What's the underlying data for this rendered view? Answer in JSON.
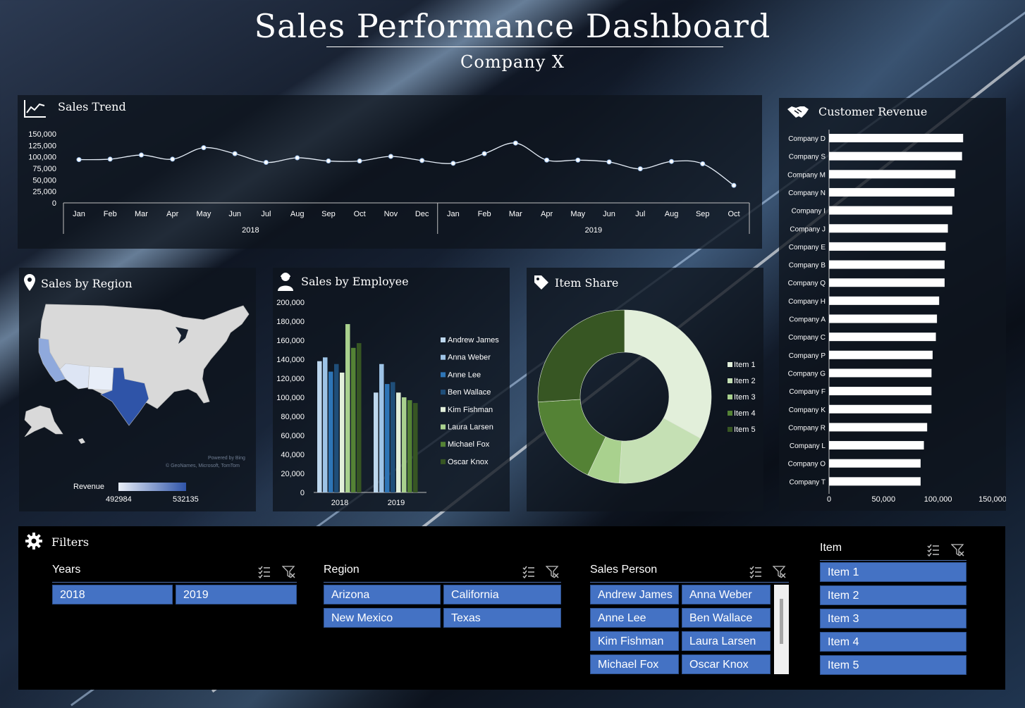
{
  "header": {
    "title": "Sales Performance Dashboard",
    "subtitle": "Company X"
  },
  "panels": {
    "trend": "Sales Trend",
    "region": "Sales by Region",
    "employee": "Sales by Employee",
    "item_share": "Item Share",
    "customer": "Customer Revenue",
    "filters": "Filters"
  },
  "region_map": {
    "legend_label": "Revenue",
    "legend_min": "492984",
    "legend_max": "532135",
    "credit1": "Powered by Bing",
    "credit2": "© GeoNames, Microsoft, TomTom",
    "colors": {
      "low": "#e8eef8",
      "high": "#2f54a8",
      "land": "#d9d9d9"
    }
  },
  "chart_data": [
    {
      "type": "line",
      "title": "Sales Trend",
      "x": [
        "Jan",
        "Feb",
        "Mar",
        "Apr",
        "May",
        "Jun",
        "Jul",
        "Aug",
        "Sep",
        "Oct",
        "Nov",
        "Dec",
        "Jan",
        "Feb",
        "Mar",
        "Apr",
        "May",
        "Jun",
        "Jul",
        "Aug",
        "Sep",
        "Oct"
      ],
      "groups": [
        {
          "label": "2018",
          "count": 12
        },
        {
          "label": "2019",
          "count": 10
        }
      ],
      "values": [
        94000,
        95000,
        104000,
        95000,
        120000,
        107000,
        88000,
        98000,
        91000,
        91000,
        101000,
        92000,
        86000,
        107000,
        130000,
        93000,
        93000,
        89000,
        74000,
        90000,
        85000,
        38000
      ],
      "yticks": [
        "150,000",
        "125,000",
        "100,000",
        "75,000",
        "50,000",
        "25,000",
        "0"
      ],
      "ylim": [
        0,
        150000
      ]
    },
    {
      "type": "bar",
      "title": "Sales by Employee",
      "categories": [
        "2018",
        "2019"
      ],
      "yticks": [
        "200,000",
        "180,000",
        "160,000",
        "140,000",
        "120,000",
        "100,000",
        "80,000",
        "60,000",
        "40,000",
        "20,000",
        "0"
      ],
      "ylim": [
        0,
        200000
      ],
      "series": [
        {
          "name": "Andrew James",
          "color": "#bdd7ee",
          "values": [
            138000,
            105000
          ]
        },
        {
          "name": "Anna Weber",
          "color": "#9dc3e6",
          "values": [
            142000,
            135000
          ]
        },
        {
          "name": "Anne Lee",
          "color": "#2e75b6",
          "values": [
            127000,
            114000
          ]
        },
        {
          "name": "Ben Wallace",
          "color": "#1f4e79",
          "values": [
            135000,
            116000
          ]
        },
        {
          "name": "Kim Fishman",
          "color": "#e2efda",
          "values": [
            126000,
            105000
          ]
        },
        {
          "name": "Laura Larsen",
          "color": "#a9d18e",
          "values": [
            177000,
            100000
          ]
        },
        {
          "name": "Michael Fox",
          "color": "#548235",
          "values": [
            152000,
            97000
          ]
        },
        {
          "name": "Oscar Knox",
          "color": "#375623",
          "values": [
            157000,
            94000
          ]
        }
      ]
    },
    {
      "type": "pie",
      "title": "Item Share",
      "labels": [
        "Item 1",
        "Item 2",
        "Item 3",
        "Item 4",
        "Item 5"
      ],
      "values": [
        33,
        18,
        6,
        17,
        26
      ],
      "colors": [
        "#e2efda",
        "#c5e0b4",
        "#a9d18e",
        "#548235",
        "#375623"
      ]
    },
    {
      "type": "bar",
      "orientation": "horizontal",
      "title": "Customer Revenue",
      "categories": [
        "Company D",
        "Company S",
        "Company M",
        "Company N",
        "Company I",
        "Company J",
        "Company E",
        "Company B",
        "Company Q",
        "Company H",
        "Company A",
        "Company C",
        "Company P",
        "Company G",
        "Company F",
        "Company K",
        "Company R",
        "Company L",
        "Company O",
        "Company T"
      ],
      "values": [
        123000,
        122000,
        116000,
        115000,
        113000,
        109000,
        107000,
        106000,
        106000,
        101000,
        99000,
        98000,
        95000,
        94000,
        94000,
        94000,
        90000,
        87000,
        84000,
        84000
      ],
      "xticks": [
        "0",
        "50,000",
        "100,000",
        "150,000"
      ],
      "xlim": [
        0,
        150000
      ]
    }
  ],
  "filters": {
    "years": {
      "title": "Years",
      "items": [
        "2018",
        "2019"
      ]
    },
    "region": {
      "title": "Region",
      "items": [
        "Arizona",
        "California",
        "New Mexico",
        "Texas"
      ]
    },
    "sales_person": {
      "title": "Sales Person",
      "items": [
        "Andrew James",
        "Anna Weber",
        "Anne Lee",
        "Ben Wallace",
        "Kim Fishman",
        "Laura Larsen",
        "Michael Fox",
        "Oscar Knox"
      ]
    },
    "item": {
      "title": "Item",
      "items": [
        "Item 1",
        "Item 2",
        "Item 3",
        "Item 4",
        "Item 5"
      ]
    }
  }
}
